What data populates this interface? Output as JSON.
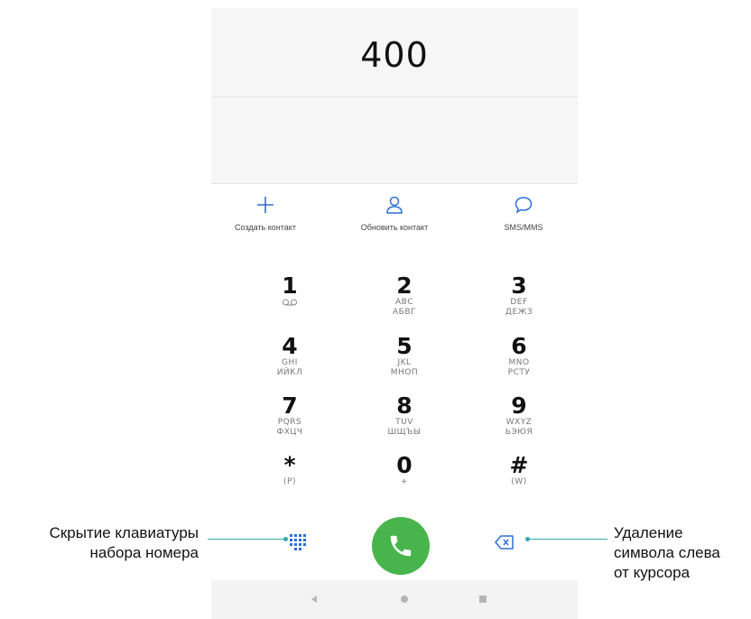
{
  "dialer": {
    "number": "400"
  },
  "actions": [
    {
      "label": "Создать контакт",
      "icon": "plus-icon"
    },
    {
      "label": "Обновить контакт",
      "icon": "person-icon"
    },
    {
      "label": "SMS/MMS",
      "icon": "chat-bubble-icon"
    }
  ],
  "keys": [
    {
      "digit": "1",
      "sub1": "ꝏ",
      "sub2": ""
    },
    {
      "digit": "2",
      "sub1": "ABC",
      "sub2": "АБВГ"
    },
    {
      "digit": "3",
      "sub1": "DEF",
      "sub2": "ДЕЖЗ"
    },
    {
      "digit": "4",
      "sub1": "GHI",
      "sub2": "ИЙКЛ"
    },
    {
      "digit": "5",
      "sub1": "JKL",
      "sub2": "МНОП"
    },
    {
      "digit": "6",
      "sub1": "MNO",
      "sub2": "РСТУ"
    },
    {
      "digit": "7",
      "sub1": "PQRS",
      "sub2": "ФХЦЧ"
    },
    {
      "digit": "8",
      "sub1": "TUV",
      "sub2": "ШЩЪЫ"
    },
    {
      "digit": "9",
      "sub1": "WXYZ",
      "sub2": "ЬЭЮЯ"
    },
    {
      "digit": "*",
      "sub1": "(P)",
      "sub2": ""
    },
    {
      "digit": "0",
      "sub1": "+",
      "sub2": ""
    },
    {
      "digit": "#",
      "sub1": "(W)",
      "sub2": ""
    }
  ],
  "callouts": {
    "left_line1": "Скрытие клавиатуры",
    "left_line2": "набора номера",
    "right_line1": "Удаление",
    "right_line2": "символа слева",
    "right_line3": "от курсора"
  },
  "colors": {
    "accent": "#2f6fd6",
    "call": "#47b54b",
    "callout": "#3aa6b0"
  }
}
